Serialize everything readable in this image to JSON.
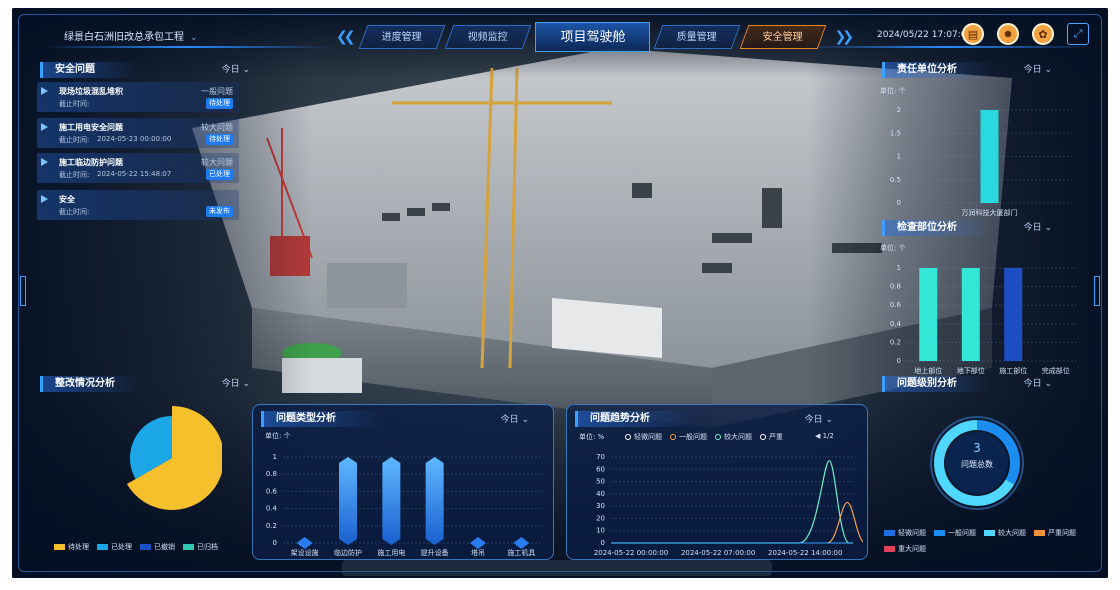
{
  "header": {
    "project_name": "绿景白石洲旧改总承包工程",
    "tabs": [
      {
        "label": "进度管理"
      },
      {
        "label": "视频监控"
      },
      {
        "label": "项目驾驶舱"
      },
      {
        "label": "质量管理"
      },
      {
        "label": "安全管理"
      }
    ],
    "datetime": "2024/05/22 17:07:09",
    "icons": [
      "printer-icon",
      "gear-icon",
      "settings-icon",
      "fullscreen-icon"
    ]
  },
  "safety_issues": {
    "title": "安全问题",
    "filter": "今日",
    "items": [
      {
        "name": "现场垃圾混乱堆积",
        "level": "一般问题",
        "time_label": "截止时间:",
        "time": "",
        "status": "待处理"
      },
      {
        "name": "施工用电安全问题",
        "level": "较大问题",
        "time_label": "截止时间:",
        "time": "2024-05-23 00:00:00",
        "status": "待处理"
      },
      {
        "name": "施工临边防护问题",
        "level": "较大问题",
        "time_label": "截止时间:",
        "time": "2024-05-22 15:48:07",
        "status": "已处理"
      },
      {
        "name": "安全",
        "level": "",
        "time_label": "截止时间:",
        "time": "",
        "status": "未发布"
      }
    ]
  },
  "rectify": {
    "title": "整改情况分析",
    "filter": "今日",
    "legend": [
      {
        "label": "待处理",
        "color": "#f5c02c"
      },
      {
        "label": "已处理",
        "color": "#1ca8e8"
      },
      {
        "label": "已撤销",
        "color": "#1d4fc4"
      },
      {
        "label": "已归档",
        "color": "#32c8b4"
      }
    ]
  },
  "responsible_unit": {
    "title": "责任单位分析",
    "filter": "今日",
    "unit": "单位: 个"
  },
  "inspect_part": {
    "title": "检查部位分析",
    "filter": "今日",
    "unit": "单位: 个"
  },
  "level_analysis": {
    "title": "问题级别分析",
    "filter": "今日",
    "total_value": "3",
    "total_label": "问题总数",
    "legend": [
      {
        "label": "轻微问题",
        "color": "#1f6fe0"
      },
      {
        "label": "一般问题",
        "color": "#1b8cf0"
      },
      {
        "label": "较大问题",
        "color": "#4fd7ff"
      },
      {
        "label": "严重问题",
        "color": "#f5923a"
      },
      {
        "label": "重大问题",
        "color": "#e0405a"
      }
    ]
  },
  "type_analysis": {
    "title": "问题类型分析",
    "filter": "今日",
    "unit": "单位: 个"
  },
  "trend_analysis": {
    "title": "问题趋势分析",
    "filter": "今日",
    "unit": "单位: %",
    "legend": [
      {
        "label": "轻微问题",
        "color": "#ffffff"
      },
      {
        "label": "一般问题",
        "color": "#f5a04a"
      },
      {
        "label": "较大问题",
        "color": "#6ff0c8"
      },
      {
        "label": "严重",
        "color": "#ffffff"
      }
    ],
    "page": "1/2"
  },
  "chart_data": [
    {
      "type": "pie",
      "title": "整改情况分析",
      "categories": [
        "待处理",
        "已处理",
        "已撤销",
        "已归档"
      ],
      "values": [
        2,
        1,
        0,
        0
      ]
    },
    {
      "type": "bar",
      "title": "责任单位分析",
      "ylabel": "单位: 个",
      "categories": [
        "万润科技大厦部门"
      ],
      "values": [
        2
      ],
      "ylim": [
        0,
        2
      ],
      "yticks": [
        "0",
        "0.5",
        "1",
        "1.5",
        "2"
      ]
    },
    {
      "type": "bar",
      "title": "检查部位分析",
      "ylabel": "单位: 个",
      "categories": [
        "地上部位",
        "地下部位",
        "施工部位",
        "完成部位"
      ],
      "values": [
        1,
        1,
        1,
        0
      ],
      "ylim": [
        0,
        1
      ],
      "yticks": [
        "0",
        "0.2",
        "0.4",
        "0.6",
        "0.8",
        "1"
      ]
    },
    {
      "type": "bar",
      "title": "问题类型分析",
      "ylabel": "单位: 个",
      "categories": [
        "架设设施",
        "临边防护",
        "施工用电",
        "提升设备",
        "塔吊",
        "施工机具"
      ],
      "values": [
        0,
        1,
        1,
        1,
        0,
        0
      ],
      "ylim": [
        0,
        1
      ],
      "yticks": [
        "0",
        "0.2",
        "0.4",
        "0.6",
        "0.8",
        "1"
      ]
    },
    {
      "type": "line",
      "title": "问题趋势分析",
      "ylabel": "单位: %",
      "x": [
        "2024-05-22 00:00:00",
        "2024-05-22 07:00:00",
        "2024-05-22 14:00:00"
      ],
      "ylim": [
        0,
        70
      ],
      "yticks": [
        "0",
        "10",
        "20",
        "30",
        "40",
        "50",
        "60",
        "70"
      ],
      "series": [
        {
          "name": "较大问题",
          "peak_x": "2024-05-22 14:00:00",
          "peak": 67
        },
        {
          "name": "一般问题",
          "peak": 33
        }
      ]
    },
    {
      "type": "pie",
      "title": "问题级别分析",
      "categories": [
        "一般问题",
        "较大问题"
      ],
      "values": [
        1,
        2
      ]
    }
  ]
}
